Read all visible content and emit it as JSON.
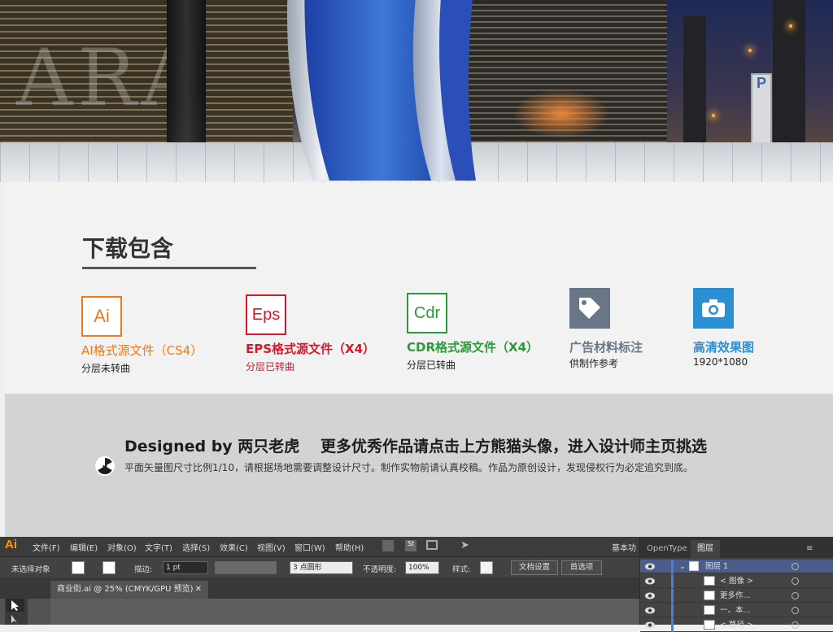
{
  "download": {
    "title": "下载包含",
    "formats": [
      {
        "icon": "Ai",
        "label": "AI格式源文件（CS4）",
        "sub": "分层未转曲",
        "color": "#f07a1a"
      },
      {
        "icon": "Eps",
        "label": "EPS格式源文件（X4）",
        "sub": "分层已转曲",
        "color": "#d8182a"
      },
      {
        "icon": "Cdr",
        "label": "CDR格式源文件（X4）",
        "sub": "分层已转曲",
        "color": "#2b9a3a"
      },
      {
        "icon": "tag-icon",
        "label": "广告材料标注",
        "sub": "供制作参考",
        "color": "#697687"
      },
      {
        "icon": "camera-icon",
        "label": "高清效果图",
        "sub": "1920*1080",
        "color": "#2a8fd3"
      }
    ]
  },
  "designer": {
    "brand": "Designed by 两只老虎",
    "promo": "更多优秀作品请点击上方熊猫头像，进入设计师主页挑选",
    "note": "平面矢量图尺寸比例1/10，请根据场地需要调整设计尺寸。制作实物前请认真校稿。作品为原创设计，发现侵权行为必定追究到底。"
  },
  "hero": {
    "storefront_letters": "ARA",
    "parking_sign": "P"
  },
  "illustrator": {
    "app_icon": "Ai",
    "menus": [
      "文件(F)",
      "编辑(E)",
      "对象(O)",
      "文字(T)",
      "选择(S)",
      "效果(C)",
      "视图(V)",
      "窗口(W)",
      "帮助(H)"
    ],
    "workspace": "基本功",
    "control": {
      "selection": "未选择对象",
      "stroke_label": "描边:",
      "stroke_value": "1 pt",
      "brush_value": "3 点圆形",
      "opacity_label": "不透明度:",
      "opacity_value": "100%",
      "style_label": "样式:",
      "doc_setup": "文档设置",
      "prefs": "首选项"
    },
    "document_tab": "商业街.ai @ 25% (CMYK/GPU 预览)",
    "panel": {
      "tabs": [
        "OpenType",
        "图层"
      ],
      "active_tab": "图层",
      "layers": [
        {
          "name": "图层 1",
          "level": 0
        },
        {
          "name": "< 图像 >",
          "level": 1
        },
        {
          "name": "更多作...",
          "level": 1
        },
        {
          "name": "一、本...",
          "level": 1
        },
        {
          "name": "< 路径 >",
          "level": 1
        }
      ]
    }
  }
}
